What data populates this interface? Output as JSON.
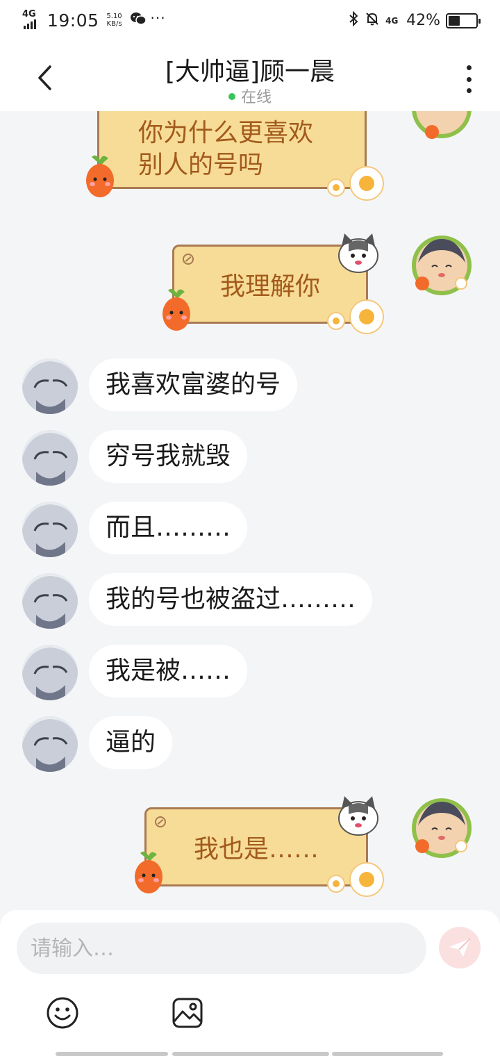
{
  "status_bar": {
    "network": "4G",
    "time": "19:05",
    "speed_value": "5.10",
    "speed_unit": "KB/s",
    "right_network": "4G",
    "battery_percent": "42%",
    "battery_level": 0.42
  },
  "header": {
    "title": "[大帅逼]顾一晨",
    "status": "在线"
  },
  "messages": [
    {
      "side": "right",
      "text_lines": [
        "你为什么更喜欢",
        "别人的号吗"
      ]
    },
    {
      "side": "right",
      "text": "我理解你"
    },
    {
      "side": "left",
      "text": "我喜欢富婆的号"
    },
    {
      "side": "left",
      "text": "穷号我就毁"
    },
    {
      "side": "left",
      "text": "而且………"
    },
    {
      "side": "left",
      "text": "我的号也被盗过………"
    },
    {
      "side": "left",
      "text": "我是被……"
    },
    {
      "side": "left",
      "text": "逼的"
    },
    {
      "side": "right",
      "text": "我也是……"
    }
  ],
  "input": {
    "placeholder": "请输入…"
  },
  "icons": {
    "back": "chevron-left-icon",
    "more": "more-vertical-icon",
    "send": "paper-plane-icon",
    "emoji": "smiley-icon",
    "image": "image-icon"
  },
  "colors": {
    "online_dot": "#3bc35a",
    "bubble_fill": "#f7dc97",
    "bubble_border": "#a87a52",
    "bubble_text": "#a25a1c",
    "send_button": "#fbe0e0"
  }
}
